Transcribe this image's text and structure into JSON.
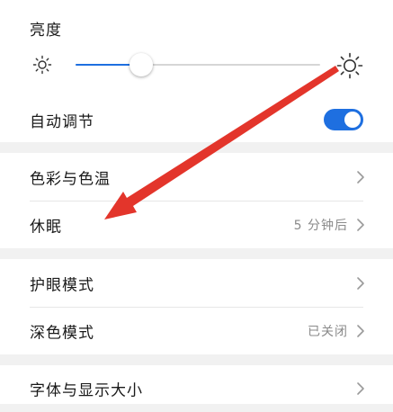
{
  "brightness": {
    "title": "亮度",
    "level_percent": 27,
    "auto_label": "自动调节",
    "auto_enabled": true
  },
  "display": {
    "items": [
      {
        "label": "色彩与色温",
        "value": ""
      },
      {
        "label": "休眠",
        "value": "5 分钟后"
      }
    ]
  },
  "eye": {
    "items": [
      {
        "label": "护眼模式",
        "value": ""
      },
      {
        "label": "深色模式",
        "value": "已关闭"
      }
    ]
  },
  "font": {
    "items": [
      {
        "label": "字体与显示大小",
        "value": ""
      }
    ]
  },
  "colors": {
    "accent": "#1e6fe0",
    "annotation": "#e3352b"
  },
  "icons": {
    "brightness_low": "sun-small-icon",
    "brightness_high": "sun-large-icon",
    "chevron": "chevron-right-icon"
  }
}
